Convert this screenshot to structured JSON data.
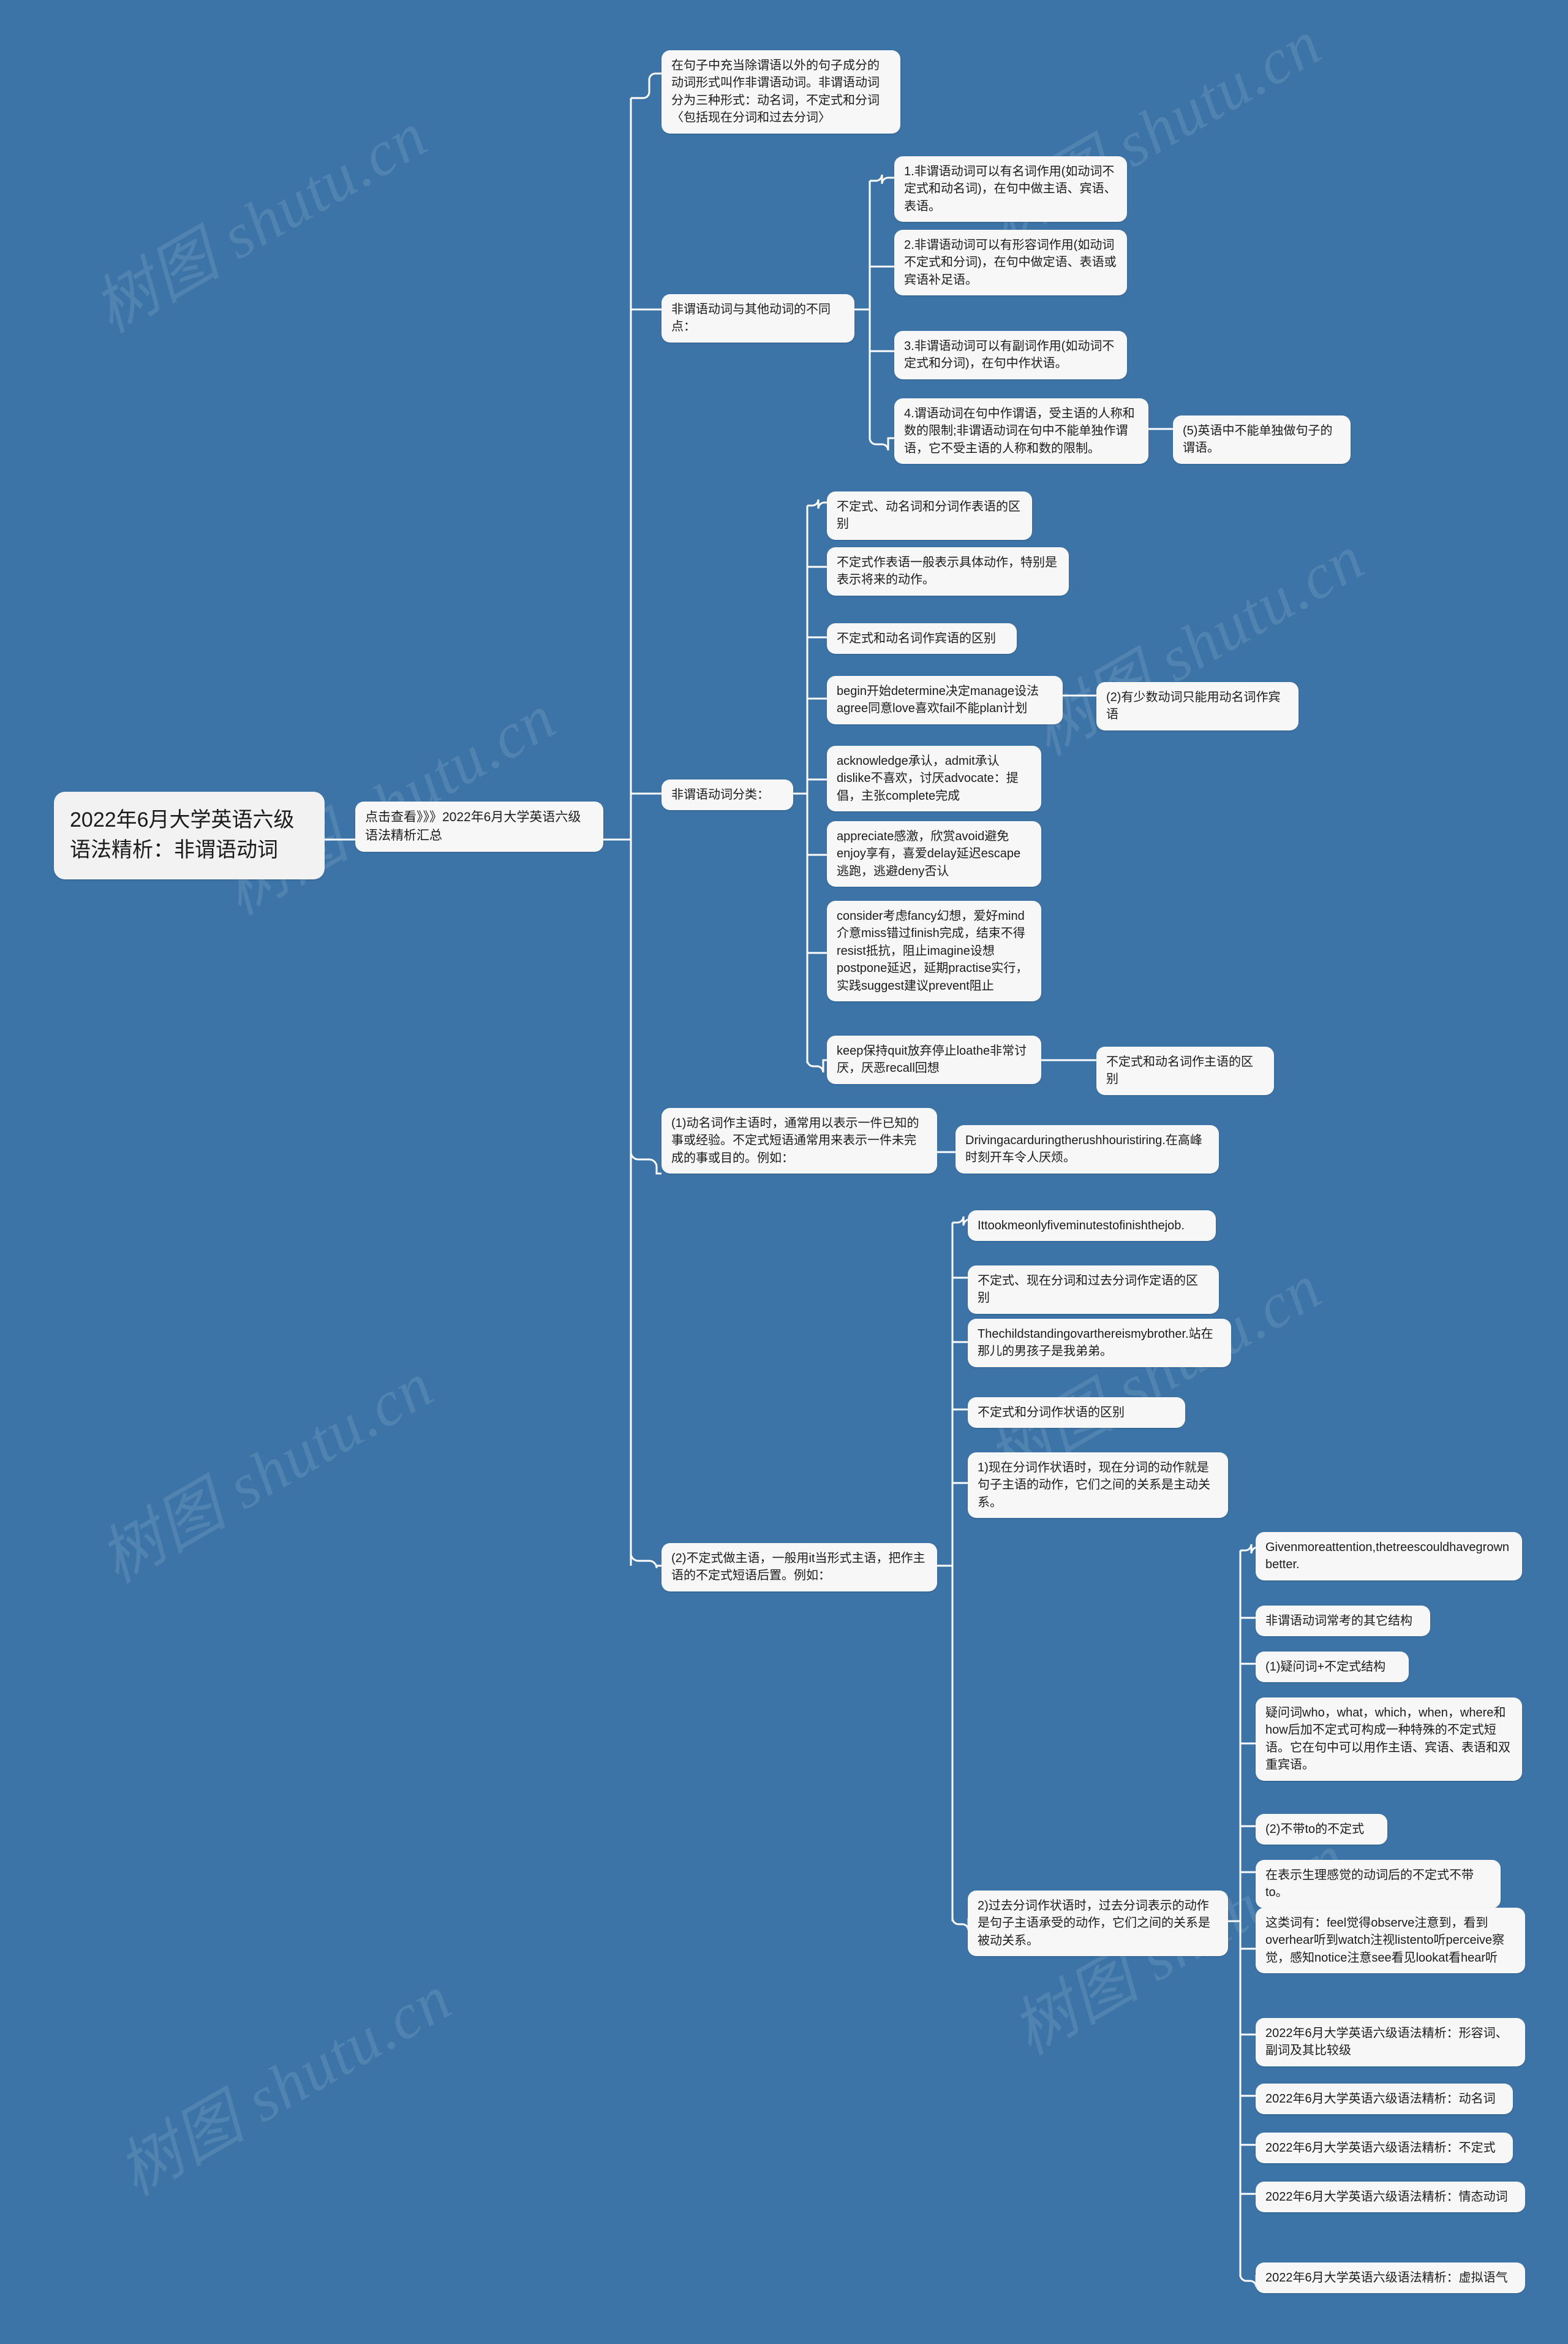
{
  "meta": {
    "background_color": "#3c74a8",
    "node_color": "#f7f7f7",
    "text_color": "#1b1b1b",
    "watermark_text": "树图 shutu.cn"
  },
  "root": {
    "label": "2022年6月大学英语六级语法精析：非谓语动词"
  },
  "link_node": {
    "label": "点击查看》》》2022年6月大学英语六级语法精析汇总"
  },
  "branches": [
    {
      "id": "definition",
      "label": "在句子中充当除谓语以外的句子成分的动词形式叫作非谓语动词。非谓语动词分为三种形式：动名词，不定式和分词〈包括现在分词和过去分词〉"
    },
    {
      "id": "differences",
      "label": "非谓语动词与其他动词的不同点：",
      "children": [
        {
          "label": "1.非谓语动词可以有名词作用(如动词不定式和动名词)，在句中做主语、宾语、表语。"
        },
        {
          "label": "2.非谓语动词可以有形容词作用(如动词不定式和分词)，在句中做定语、表语或宾语补足语。"
        },
        {
          "label": "3.非谓语动词可以有副词作用(如动词不定式和分词)，在句中作状语。"
        },
        {
          "label": "4.谓语动词在句中作谓语，受主语的人称和数的限制;非谓语动词在句中不能单独作谓语，它不受主语的人称和数的限制。",
          "children": [
            {
              "label": "(5)英语中不能单独做句子的谓语。"
            }
          ]
        }
      ]
    },
    {
      "id": "classification",
      "label": "非谓语动词分类：",
      "children": [
        {
          "label": "不定式、动名词和分词作表语的区别"
        },
        {
          "label": "不定式作表语一般表示具体动作，特别是表示将来的动作。"
        },
        {
          "label": "不定式和动名词作宾语的区别"
        },
        {
          "label": "begin开始determine决定manage设法agree同意love喜欢fail不能plan计划",
          "children": [
            {
              "label": "(2)有少数动词只能用动名词作宾语"
            }
          ]
        },
        {
          "label": "acknowledge承认，admit承认dislike不喜欢，讨厌advocate：提倡，主张complete完成"
        },
        {
          "label": "appreciate感激，欣赏avoid避免enjoy享有，喜爱delay延迟escape逃跑，逃避deny否认"
        },
        {
          "label": "consider考虑fancy幻想，爱好mind介意miss错过finish完成，结束不得resist抵抗，阻止imagine设想postpone延迟，延期practise实行，实践suggest建议prevent阻止"
        },
        {
          "label": "keep保持quit放弃停止loathe非常讨厌，厌恶recall回想",
          "children": [
            {
              "label": "不定式和动名词作主语的区别"
            }
          ]
        }
      ]
    },
    {
      "id": "gerund-subject",
      "label": "(1)动名词作主语时，通常用以表示一件已知的事或经验。不定式短语通常用来表示一件未完成的事或目的。例如：",
      "children": [
        {
          "label": "Drivingacarduringtherushhouristiring.在高峰时刻开车令人厌烦。"
        }
      ]
    },
    {
      "id": "inf-subject",
      "label": "(2)不定式做主语，一般用it当形式主语，把作主语的不定式短语后置。例如：",
      "children": [
        {
          "label": "Ittookmeonlyfiveminutestofinishthejob."
        },
        {
          "label": "不定式、现在分词和过去分词作定语的区别"
        },
        {
          "label": "Thechildstandingovarthereismybrother.站在那儿的男孩子是我弟弟。"
        },
        {
          "label": "不定式和分词作状语的区别"
        },
        {
          "label": "1)现在分词作状语时，现在分词的动作就是句子主语的动作，它们之间的关系是主动关系。"
        },
        {
          "label": "2)过去分词作状语时，过去分词表示的动作是句子主语承受的动作，它们之间的关系是被动关系。",
          "children": [
            {
              "label": "Givenmoreattention,thetreescouldhavegrownbetter."
            },
            {
              "label": "非谓语动词常考的其它结构"
            },
            {
              "label": "(1)疑问词+不定式结构"
            },
            {
              "label": "疑问词who，what，which，when，where和how后加不定式可构成一种特殊的不定式短语。它在句中可以用作主语、宾语、表语和双重宾语。"
            },
            {
              "label": "(2)不带to的不定式"
            },
            {
              "label": "在表示生理感觉的动词后的不定式不带to。"
            },
            {
              "label": "这类词有：feel觉得observe注意到，看到overhear听到watch注视listento听perceive察觉，感知notice注意see看见lookat看hear听"
            },
            {
              "label": "2022年6月大学英语六级语法精析：形容词、副词及其比较级"
            },
            {
              "label": "2022年6月大学英语六级语法精析：动名词"
            },
            {
              "label": "2022年6月大学英语六级语法精析：不定式"
            },
            {
              "label": "2022年6月大学英语六级语法精析：情态动词"
            },
            {
              "label": "2022年6月大学英语六级语法精析：虚拟语气"
            }
          ]
        }
      ]
    }
  ]
}
